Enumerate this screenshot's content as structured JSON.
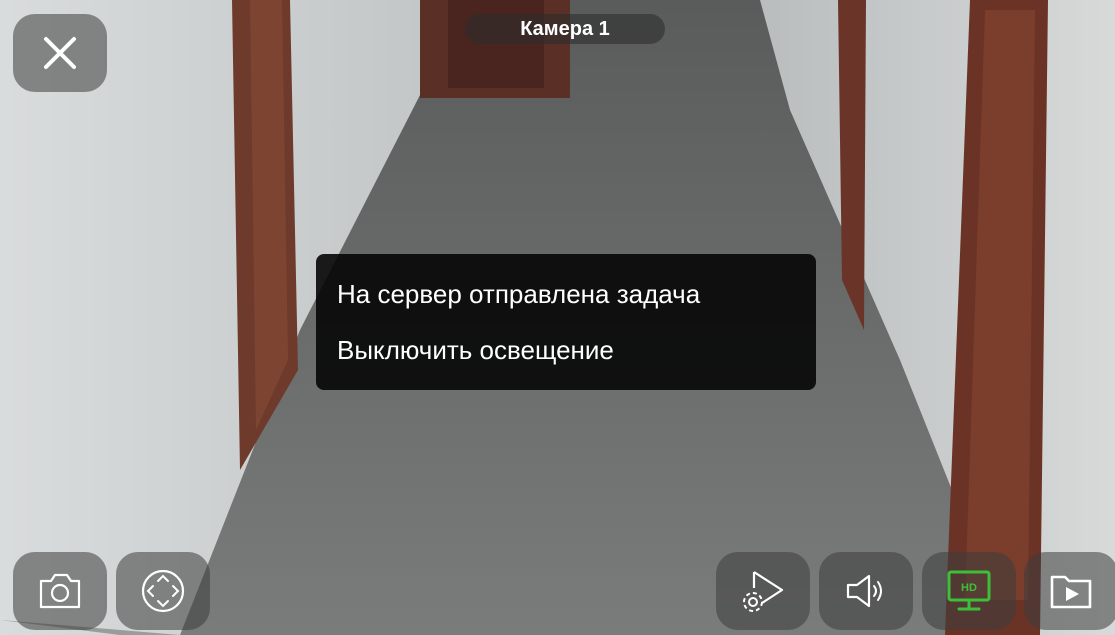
{
  "header": {
    "camera_title": "Камера 1"
  },
  "toast": {
    "line1": "На сервер отправлена задача",
    "line2": "Выключить освещение"
  },
  "hd_badge": "HD",
  "colors": {
    "hd_active": "#3dbf3a",
    "icon": "#ffffff"
  },
  "icons": {
    "close": "close-icon",
    "snapshot": "camera-icon",
    "ptz": "ptz-joystick-icon",
    "play_settings": "play-settings-icon",
    "sound": "speaker-icon",
    "hd": "hd-monitor-icon",
    "archive": "folder-play-icon"
  }
}
